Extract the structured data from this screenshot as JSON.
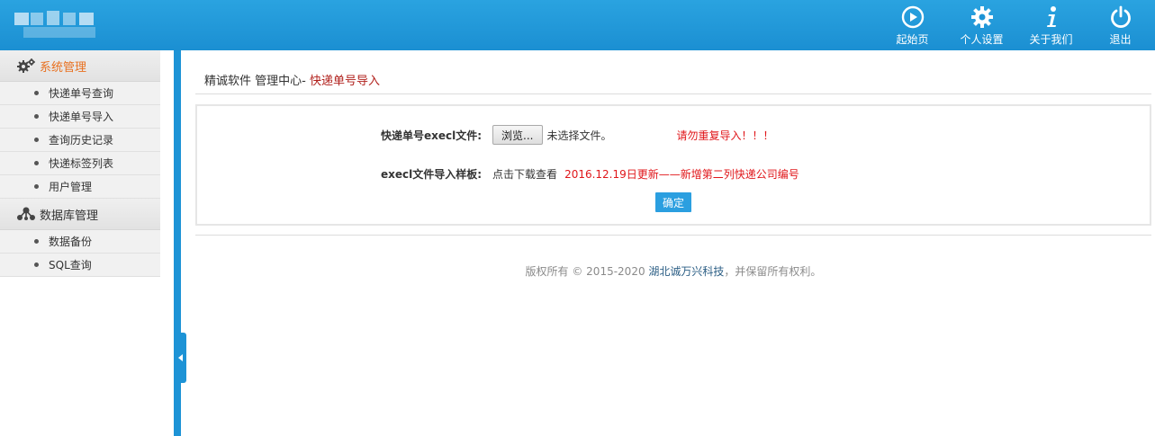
{
  "header": {
    "nav": [
      {
        "label": "起始页",
        "icon": "play-circle-icon"
      },
      {
        "label": "个人设置",
        "icon": "gear-icon"
      },
      {
        "label": "关于我们",
        "icon": "info-icon"
      },
      {
        "label": "退出",
        "icon": "power-icon"
      }
    ]
  },
  "sidebar": {
    "sections": [
      {
        "title": "系统管理",
        "icon": "gears-icon",
        "active": true,
        "items": [
          "快递单号查询",
          "快递单号导入",
          "查询历史记录",
          "快递标签列表",
          "用户管理"
        ]
      },
      {
        "title": "数据库管理",
        "icon": "share-nodes-icon",
        "active": false,
        "items": [
          "数据备份",
          "SQL查询"
        ]
      }
    ]
  },
  "breadcrumb": {
    "prefix": "精诚软件 管理中心- ",
    "current": "快递单号导入"
  },
  "form": {
    "file_label": "快递单号execl文件:",
    "browse_label": "浏览...",
    "no_file": "未选择文件。",
    "warning": "请勿重复导入！！！",
    "sample_label": "execl文件导入样板:",
    "download_link": "点击下载查看",
    "update_note": "2016.12.19日更新——新增第二列快递公司编号",
    "submit_label": "确定"
  },
  "footer": {
    "prefix": "版权所有 © 2015-2020 ",
    "company": "湖北诚万兴科技",
    "suffix": "，并保留所有权利。"
  },
  "colors": {
    "header": "#1b8fd2",
    "accent": "#e8701f",
    "warning": "#e0161a",
    "button": "#2b9fe0"
  }
}
